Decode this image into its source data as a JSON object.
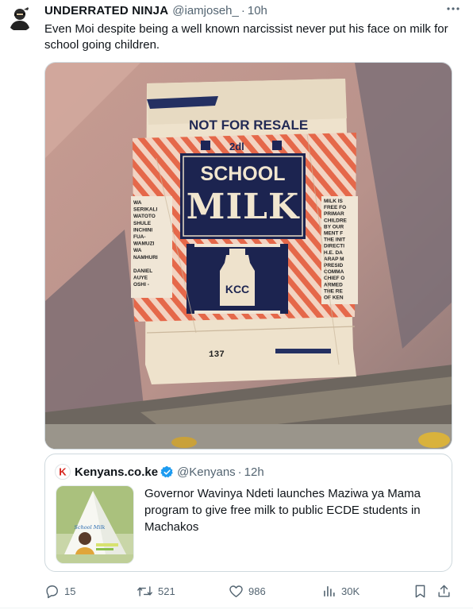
{
  "author": {
    "display_name": "UNDERRATED NINJA",
    "handle": "@iamjoseh_",
    "separator": "·",
    "time": "10h"
  },
  "more_icon": "more-icon",
  "tweet": {
    "text": "Even Moi despite being a well  known narcissist never put his face on milk for school going children."
  },
  "photo": {
    "label_not_for_resale": "NOT FOR RESALE",
    "label_volume": "2dl",
    "label_school": "SCHOOL",
    "label_milk": "MILK",
    "label_brand": "KCC",
    "label_number": "137",
    "left_panel_text": [
      "WA",
      "SERIKALI",
      "WATOTO",
      "SHULE",
      "INCHINI",
      "FUA-",
      "WAMUZI",
      "WA",
      "NAMHURI",
      "",
      "DANIEL",
      "AUYE",
      "OSHI -"
    ],
    "right_panel_text": [
      "MILK IS",
      "FREE FO",
      "PRIMAR",
      "CHILDRE",
      "BY OUR",
      "MENT F",
      "THE INIT",
      "DIRECTI",
      "H.E. DA",
      "ARAP M",
      "PRESID",
      "COMMA",
      "CHIEF O",
      "ARMED",
      "THE RE",
      "OF KEN"
    ]
  },
  "quote": {
    "logo_letter": "K",
    "name": "Kenyans.co.ke",
    "handle": "@Kenyans",
    "separator": "·",
    "time": "12h",
    "text": "Governor Wavinya Ndeti launches Maziwa ya Mama program to give free milk to public ECDE students in Machakos",
    "thumb_text": "School Milk"
  },
  "actions": {
    "replies": "15",
    "retweets": "521",
    "likes": "986",
    "views": "30K"
  },
  "colors": {
    "text": "#0f1419",
    "secondary": "#536471",
    "border": "#cfd9de",
    "verified": "#1d9bf0",
    "kenyans_red": "#d7261e"
  }
}
